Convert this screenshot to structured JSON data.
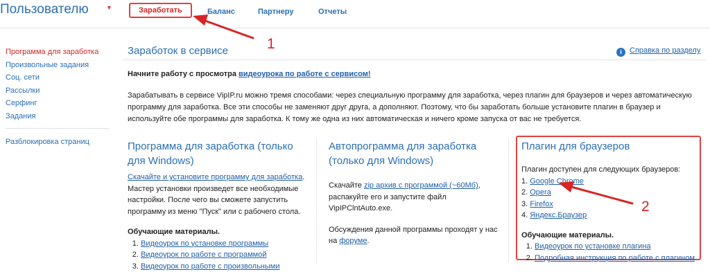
{
  "header": {
    "brand": "Пользователю",
    "nav": [
      {
        "label": "Заработать",
        "active": true
      },
      {
        "label": "Баланс"
      },
      {
        "label": "Партнеру"
      },
      {
        "label": "Отчеты"
      }
    ]
  },
  "sidebar": {
    "items": [
      "Программа для заработка",
      "Произвольные задания",
      "Соц. сети",
      "Рассылки",
      "Серфинг",
      "Задания"
    ],
    "extra": [
      "Разблокировка страниц"
    ]
  },
  "main": {
    "title": "Заработок в сервисе",
    "help_link": "Справка по разделу",
    "intro_text": "Начните работу с просмотра ",
    "intro_link": "видеоурока по работе с сервисом!",
    "description": "Зарабатывать в сервисе VipIP.ru можно тремя способами: через специальную программу для заработка, через плагин для браузеров и через автоматическую программу для заработка. Все эти способы не заменяют друг друга, а дополняют. Поэтому, что бы заработать больше установите плагин в браузер и используйте обе программы для заработка. К тому же одна из них автоматическая и ничего кроме запуска от вас не требуется."
  },
  "columns": {
    "program": {
      "title": "Программа для заработка (только для Windows)",
      "download_link": "Скачайте и установите программу для заработка",
      "text": "Мастер установки произведет все необходимые настройки. После чего вы сможете запустить программу из меню \"Пуск\" или с рабочего стола.",
      "materials_title": "Обучающие материалы.",
      "materials": [
        "Видеоурок по установке программы",
        "Видеоурок по работе с программой",
        "Видеоурок по работе с произвольными"
      ]
    },
    "auto": {
      "title": "Автопрограмма для заработка (только для Windows)",
      "text_before": "Скачайте ",
      "zip_link": "zip архив с программой (~60Мб)",
      "text_after": ", распакуйте его и запустите файл VipIPClntAuto.exe.",
      "forum_text": "Обсуждения данной программы проходят у нас на ",
      "forum_link": "форуме"
    },
    "plugin": {
      "title": "Плагин для браузеров",
      "available": "Плагин доступен для следующих браузеров:",
      "browsers": [
        "Google Chrome",
        "Opera",
        "Firefox",
        "Яндекс.Браузер"
      ],
      "materials_title": "Обучающие материалы.",
      "materials": [
        "Видеоурок по установке плагина",
        "Подробная инструкция по работе с плагином"
      ]
    }
  },
  "annotations": {
    "marker1": "1",
    "marker2": "2",
    "color": "#d82424"
  }
}
